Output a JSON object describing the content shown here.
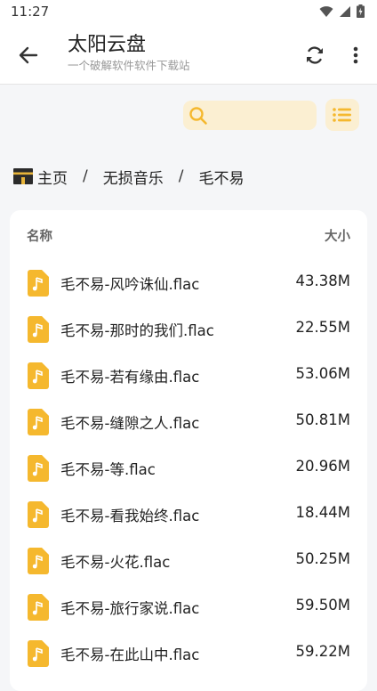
{
  "status_bar": {
    "time": "11:27"
  },
  "app_bar": {
    "title": "太阳云盘",
    "subtitle": "一个破解软件软件下载站"
  },
  "search": {
    "placeholder": "",
    "value": ""
  },
  "breadcrumb": {
    "items": [
      "主页",
      "无损音乐",
      "毛不易"
    ],
    "separator": "/"
  },
  "file_list": {
    "header_name": "名称",
    "header_size": "大小",
    "rows": [
      {
        "name": "毛不易-风吟诛仙.flac",
        "size": "43.38M"
      },
      {
        "name": "毛不易-那时的我们.flac",
        "size": "22.55M"
      },
      {
        "name": "毛不易-若有缘由.flac",
        "size": "53.06M"
      },
      {
        "name": "毛不易-缝隙之人.flac",
        "size": "50.81M"
      },
      {
        "name": "毛不易-等.flac",
        "size": "20.96M"
      },
      {
        "name": "毛不易-看我始终.flac",
        "size": "18.44M"
      },
      {
        "name": "毛不易-火花.flac",
        "size": "50.25M"
      },
      {
        "name": "毛不易-旅行家说.flac",
        "size": "59.50M"
      },
      {
        "name": "毛不易-在此山中.flac",
        "size": "59.22M"
      }
    ]
  },
  "colors": {
    "accent": "#f5b82e",
    "accent_light": "#fbefd2",
    "background": "#f5f6f8",
    "card": "#ffffff"
  },
  "icons": {
    "back": "arrow-left-icon",
    "refresh": "refresh-icon",
    "more": "more-vertical-icon",
    "search": "search-icon",
    "list": "list-icon",
    "home": "kaaba-home-icon",
    "file": "music-file-icon"
  }
}
